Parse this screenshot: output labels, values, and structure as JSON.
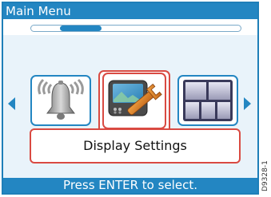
{
  "title": "Main Menu",
  "menu": {
    "items": [
      {
        "name": "Alarm",
        "icon": "alarm-bell-icon"
      },
      {
        "name": "Display Settings",
        "icon": "display-settings-icon",
        "selected": true
      },
      {
        "name": "Layout",
        "icon": "page-layout-icon"
      }
    ],
    "selected_label": "Display Settings"
  },
  "status": "Press ENTER to select.",
  "figure_code": "D9328-1",
  "colors": {
    "accent": "#2386c2",
    "selected": "#d94a42",
    "menu_bg": "#e9f3fa"
  }
}
